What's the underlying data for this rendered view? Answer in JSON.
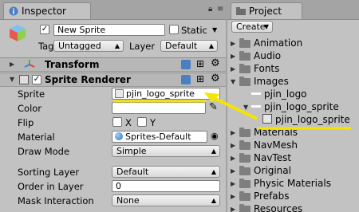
{
  "inspector": {
    "tab_label": "Inspector",
    "object_active": true,
    "object_name": "New Sprite",
    "static_label": "Static",
    "tag_label": "Tag",
    "tag_value": "Untagged",
    "layer_label": "Layer",
    "layer_value": "Default",
    "components": {
      "transform": {
        "title": "Transform"
      },
      "sprite_renderer": {
        "title": "Sprite Renderer",
        "enabled": true,
        "fields": {
          "sprite_label": "Sprite",
          "sprite_value": "pjin_logo_sprite",
          "color_label": "Color",
          "color_value": "#ffffff",
          "flip_label": "Flip",
          "flip_x": "X",
          "flip_y": "Y",
          "material_label": "Material",
          "material_value": "Sprites-Default",
          "draw_mode_label": "Draw Mode",
          "draw_mode_value": "Simple",
          "sorting_layer_label": "Sorting Layer",
          "sorting_layer_value": "Default",
          "order_label": "Order in Layer",
          "order_value": "0",
          "mask_label": "Mask Interaction",
          "mask_value": "None"
        }
      }
    }
  },
  "project": {
    "tab_label": "Project",
    "create_label": "Create",
    "tree": [
      {
        "label": "Animation",
        "kind": "folder",
        "expanded": false
      },
      {
        "label": "Audio",
        "kind": "folder",
        "expanded": false
      },
      {
        "label": "Fonts",
        "kind": "folder",
        "expanded": false
      },
      {
        "label": "Images",
        "kind": "folder",
        "expanded": true
      },
      {
        "label": "pjin_logo",
        "kind": "texture"
      },
      {
        "label": "pjin_logo_sprite",
        "kind": "texture",
        "expanded": true
      },
      {
        "label": "pjin_logo_sprite",
        "kind": "sprite"
      },
      {
        "label": "Materials",
        "kind": "folder",
        "expanded": false
      },
      {
        "label": "NavMesh",
        "kind": "folder",
        "expanded": false
      },
      {
        "label": "NavTest",
        "kind": "folder",
        "expanded": false
      },
      {
        "label": "Original",
        "kind": "folder",
        "expanded": false
      },
      {
        "label": "Physic Materials",
        "kind": "folder",
        "expanded": false
      },
      {
        "label": "Prefabs",
        "kind": "folder",
        "expanded": false
      },
      {
        "label": "Resources",
        "kind": "folder",
        "expanded": false
      }
    ]
  },
  "annotation": {
    "color": "#f5e400"
  }
}
